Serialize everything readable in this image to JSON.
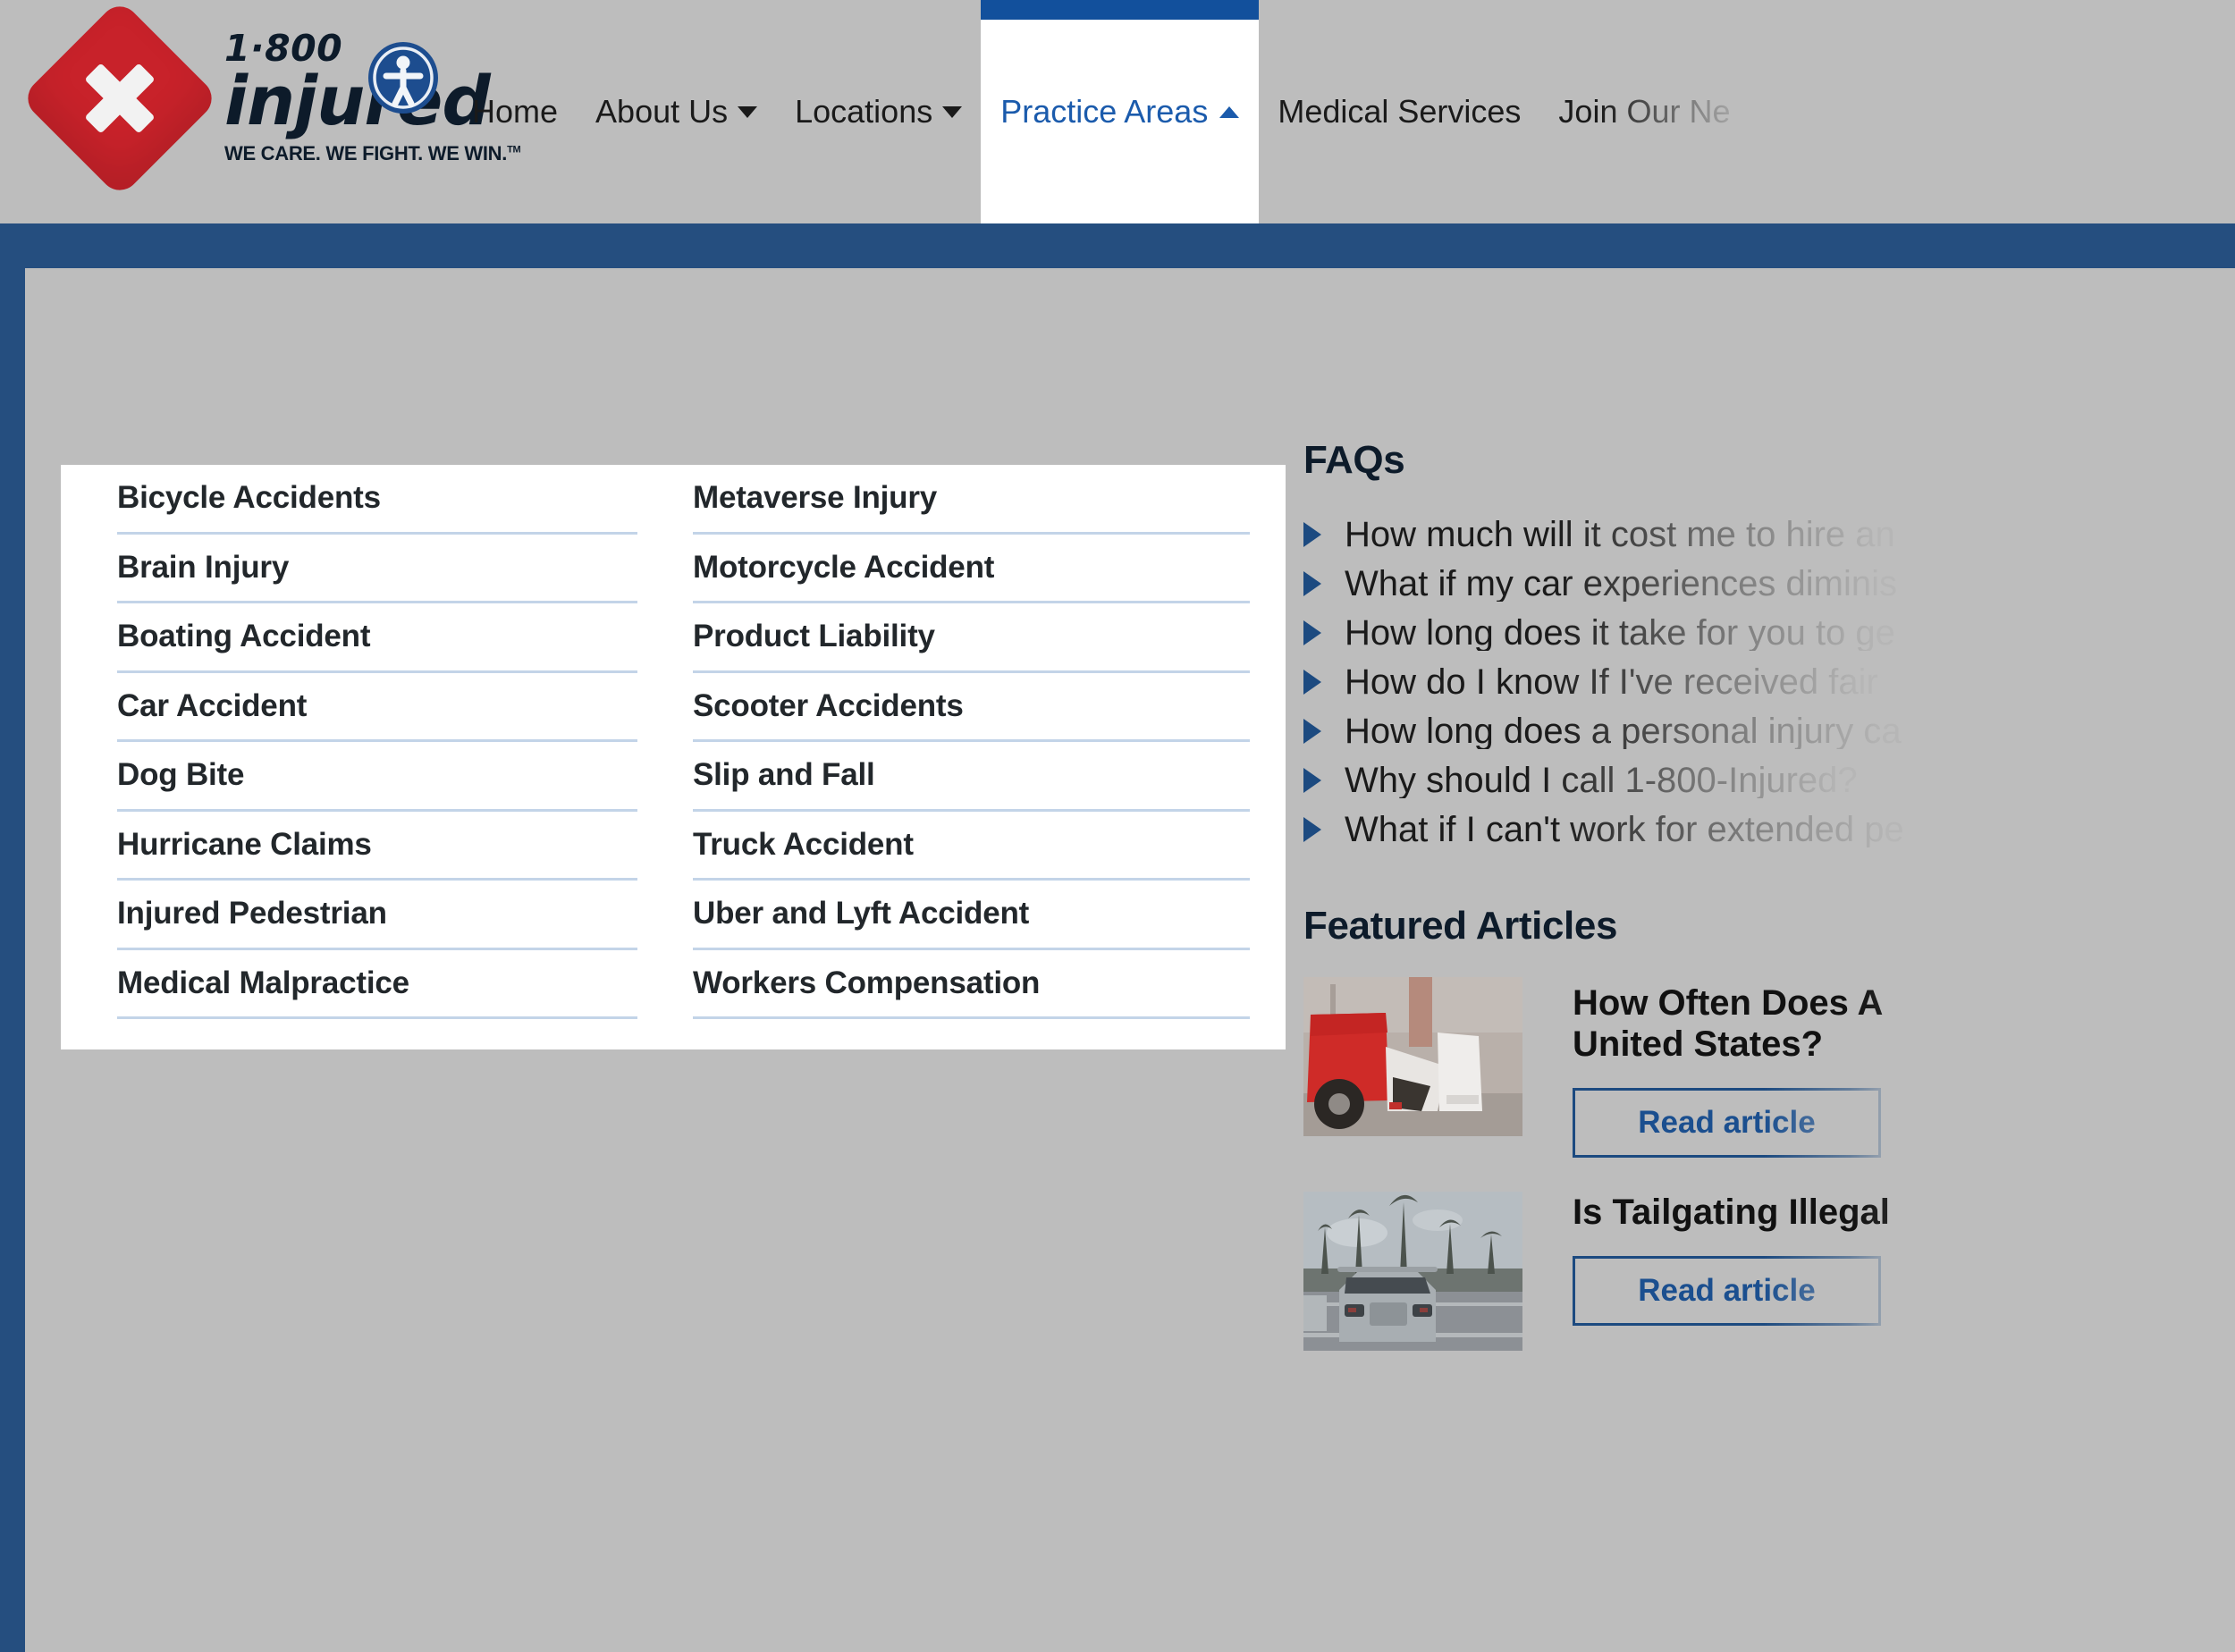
{
  "brand": {
    "phone_prefix": "1·800",
    "name": "injured",
    "tagline": "WE CARE. WE FIGHT. WE WIN.",
    "tagline_mark": "TM",
    "diamond_color": "#c8222a",
    "wordmark_color": "#0d1b2a"
  },
  "accessibility": {
    "icon": "accessibility-person-icon",
    "color": "#1d4d8f"
  },
  "nav": {
    "items": [
      {
        "label": "Home",
        "caret": "none",
        "state": "default"
      },
      {
        "label": "About Us",
        "caret": "down",
        "state": "default"
      },
      {
        "label": "Locations",
        "caret": "down",
        "state": "default"
      },
      {
        "label": "Practice Areas",
        "caret": "up",
        "state": "active"
      },
      {
        "label": "Medical Services",
        "caret": "none",
        "state": "default"
      },
      {
        "label": "Join Our Ne",
        "caret": "none",
        "state": "cut-off"
      }
    ],
    "active_accent": "#12509c",
    "active_text_color": "#1b5bac"
  },
  "theme": {
    "page_background": "#bdbdbd",
    "band_blue": "#254e7f",
    "divider_blue": "#c3d4e8",
    "link_blue": "#1b4f8f"
  },
  "dropdown": {
    "column_left": [
      "Bicycle Accidents",
      "Brain Injury",
      "Boating Accident",
      "Car Accident",
      "Dog Bite",
      "Hurricane Claims",
      "Injured Pedestrian",
      "Medical Malpractice"
    ],
    "column_right": [
      "Metaverse Injury",
      "Motorcycle Accident",
      "Product Liability",
      "Scooter Accidents",
      "Slip and Fall",
      "Truck Accident",
      "Uber and Lyft Accident",
      "Workers Compensation"
    ]
  },
  "faqs": {
    "title": "FAQs",
    "bullet_icon": "triangle-right-icon",
    "items": [
      "How much will it cost me to hire an",
      "What if my car experiences diminis",
      "How long does it take for you to ge",
      "How do I know If I've received fair",
      "How long does a personal injury ca",
      "Why should I call 1-800-Injured?",
      "What if I can't work for extended pe"
    ]
  },
  "featured_articles": {
    "title": "Featured Articles",
    "items": [
      {
        "title": "How Often Does A\nUnited States?",
        "button_label": "Read article",
        "thumb": "car-crash-red-truck-photo"
      },
      {
        "title": "Is Tailgating Illegal",
        "button_label": "Read article",
        "thumb": "suv-highway-palm-trees-photo"
      }
    ]
  }
}
